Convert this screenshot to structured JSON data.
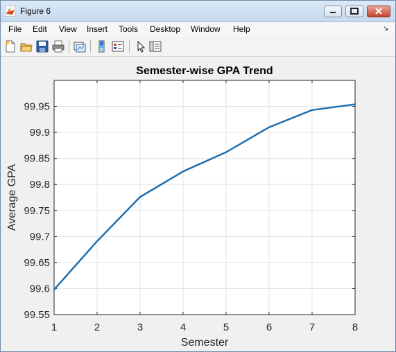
{
  "window": {
    "title": "Figure 6"
  },
  "menu": {
    "items": [
      "File",
      "Edit",
      "View",
      "Insert",
      "Tools",
      "Desktop",
      "Window",
      "Help"
    ],
    "overflow_arrow": "↘"
  },
  "toolbar": {
    "icons": [
      "new-figure-icon",
      "open-file-icon",
      "save-icon",
      "print-icon",
      "link-plot-icon",
      "insert-colorbar-icon",
      "insert-legend-icon",
      "pointer-icon",
      "property-editor-icon"
    ]
  },
  "chart_data": {
    "type": "line",
    "title": "Semester-wise GPA Trend",
    "xlabel": "Semester",
    "ylabel": "Average GPA",
    "xlim": [
      1,
      8
    ],
    "ylim": [
      99.55,
      100
    ],
    "x_ticks": [
      "1",
      "2",
      "3",
      "4",
      "5",
      "6",
      "7",
      "8"
    ],
    "y_ticks": [
      "99.55",
      "99.6",
      "99.65",
      "99.7",
      "99.75",
      "99.8",
      "99.85",
      "99.9",
      "99.95"
    ],
    "grid": true,
    "series": [
      {
        "x": [
          1,
          2,
          3,
          4,
          5,
          6,
          7,
          8
        ],
        "y": [
          99.598,
          99.691,
          99.776,
          99.825,
          99.862,
          99.91,
          99.943,
          99.954
        ],
        "color": "#1f6fb0"
      }
    ]
  }
}
